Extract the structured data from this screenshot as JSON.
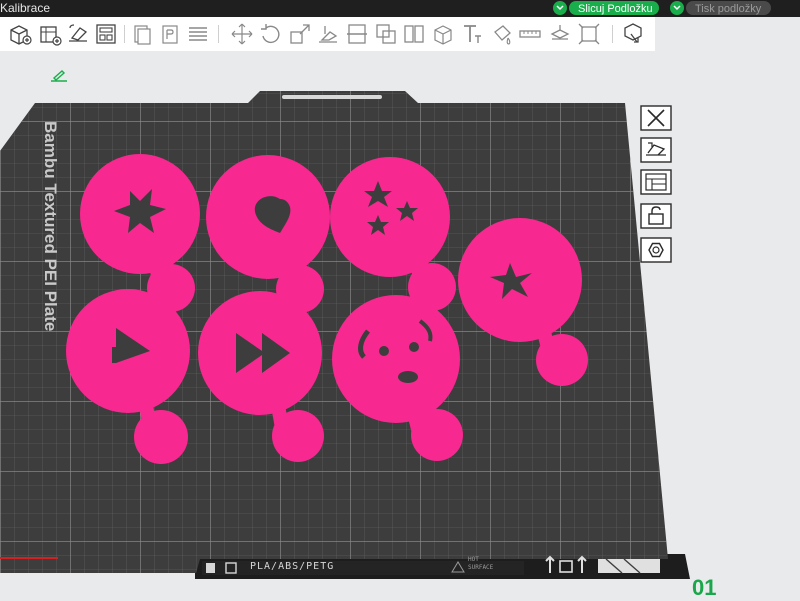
{
  "app": {
    "title": "Kalibrace"
  },
  "header": {
    "slice_button_label": "Slicuj Podložku",
    "print_button_label": "Tisk podložky",
    "accent_color": "#19ae4b"
  },
  "toolbar": {
    "icons": [
      "add-cube-icon",
      "add-plate-icon",
      "auto-orient-icon",
      "arrange-icon",
      "copy-icon",
      "paste-icon",
      "layers-icon",
      "move-icon",
      "rotate-icon",
      "scale-icon",
      "lay-on-face-icon",
      "cut-icon",
      "boolean-icon",
      "split-icon",
      "support-paint-icon",
      "text-icon",
      "seam-paint-icon",
      "measure-icon",
      "assembly-icon",
      "variable-layer-icon"
    ]
  },
  "viewport": {
    "plate_name": "Bambu Textured PEI Plate",
    "plate_number": "01",
    "filament_label": "PLA/ABS/PETG",
    "hot_surface_label_1": "HOT",
    "hot_surface_label_2": "SURFACE",
    "model_color": "#f7288f",
    "side_buttons": [
      "close-plate-icon",
      "arrange-plate-icon",
      "plate-settings-icon",
      "lock-plate-icon",
      "plate-type-icon"
    ]
  }
}
